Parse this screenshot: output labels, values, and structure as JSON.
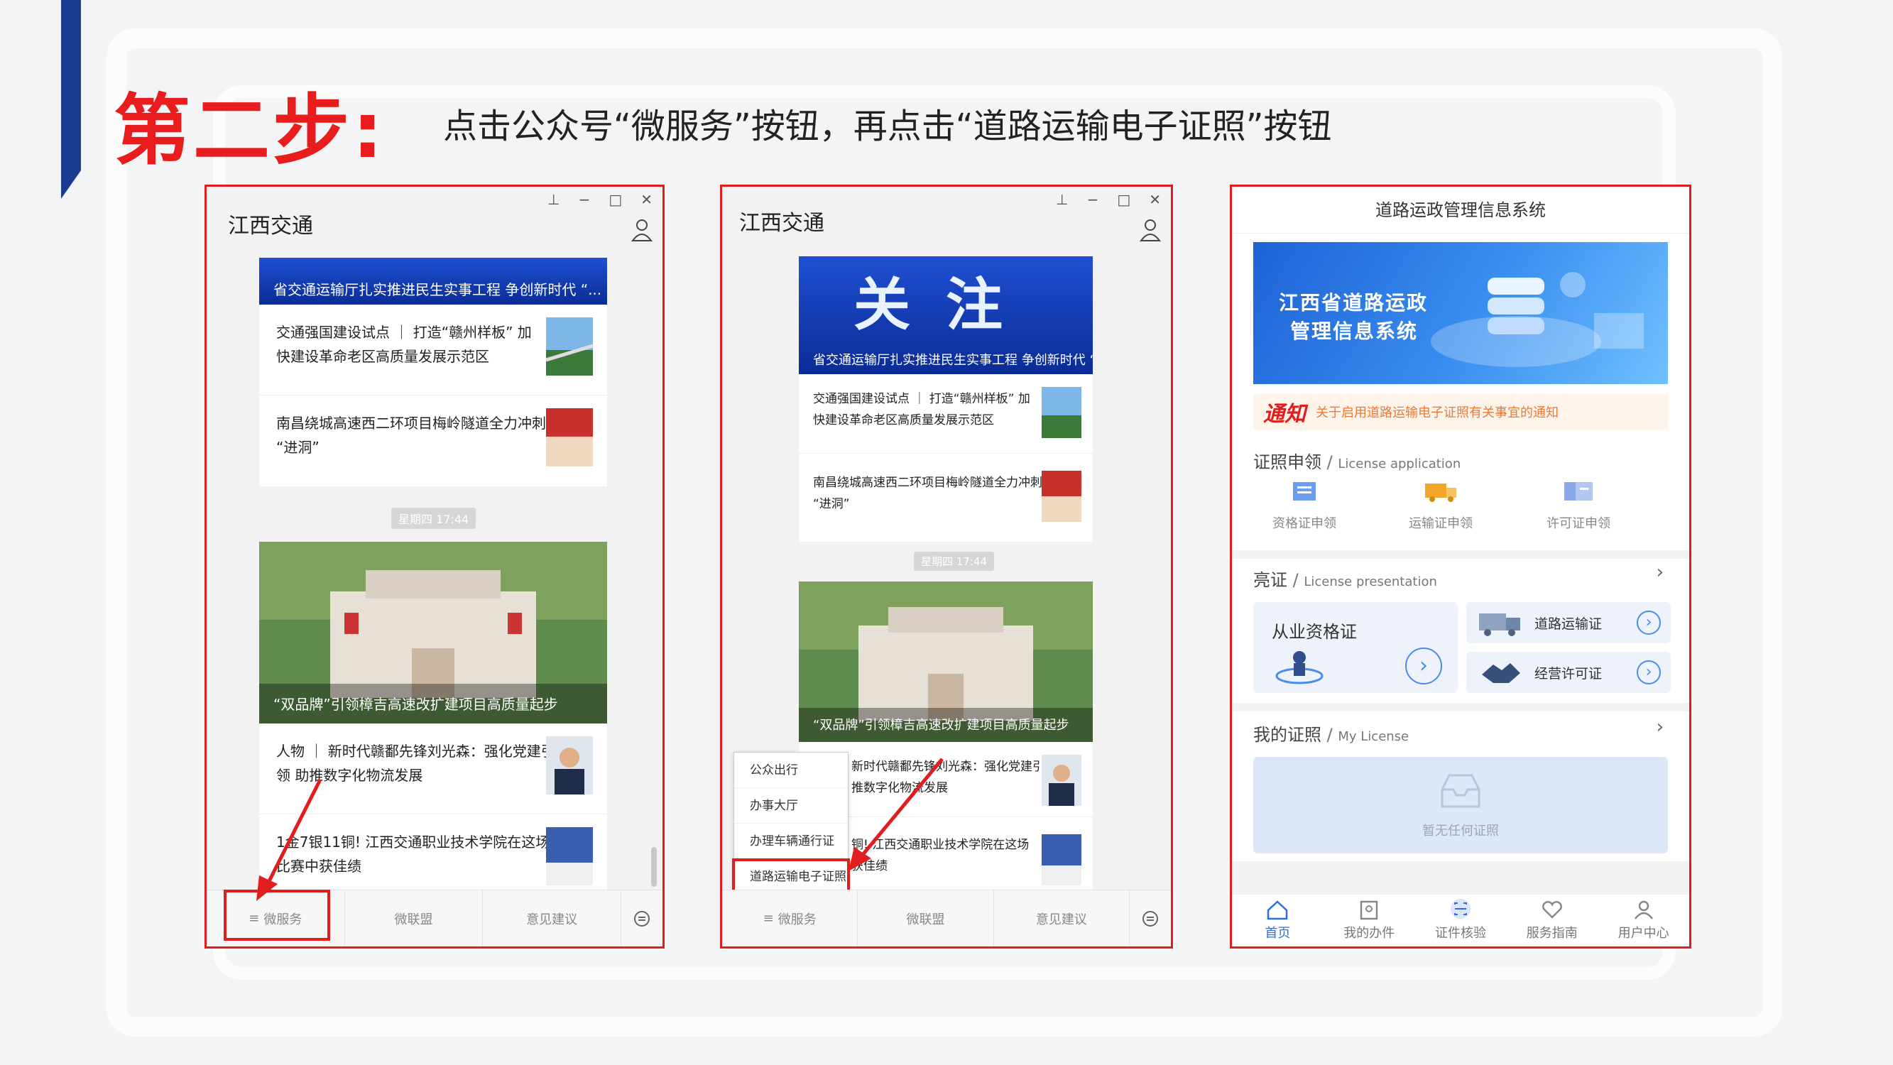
{
  "heading": {
    "step": "第二步:",
    "instruction": "点击公众号“微服务”按钮，再点击“道路运输电子证照”按钮"
  },
  "colors": {
    "accent_red": "#e11d1d",
    "brand_blue": "#1a3b8f",
    "link_blue": "#2f6fe0"
  },
  "wechat": {
    "title": "江西交通",
    "window_controls": [
      "pin-icon",
      "minimize-icon",
      "maximize-icon",
      "close-icon"
    ],
    "banner_caption": "省交通运输厅扎实推进民生实事工程 争创新时代 “...",
    "banner_big_text": "关注",
    "news_top": [
      {
        "line1": "交通强国建设试点 ｜ 打造“赣州样板” 加",
        "line2": "快建设革命老区高质量发展示范区"
      },
      {
        "line1": "南昌绕城高速西二环项目梅岭隧道全力冲刺",
        "line2": "“进洞”"
      }
    ],
    "timestamp": "星期四 17:44",
    "photo_caption": "“双品牌”引领樟吉高速改扩建项目高质量起步",
    "news_bottom": [
      {
        "line1": "人物 ｜ 新时代赣鄱先锋刘光森：强化党建引",
        "line2": "领 助推数字化物流发展"
      },
      {
        "line1": "1金7银11铜! 江西交通职业技术学院在这场",
        "line2": "比赛中获佳绩"
      }
    ],
    "news_bottom_p2": [
      {
        "line1": "新时代赣鄱先锋刘光森：强化党建引",
        "line2": "推数字化物流发展"
      },
      {
        "line1": "铜! 江西交通职业技术学院在这场",
        "line2": "获佳绩"
      }
    ],
    "menu": {
      "micro_service": "微服务",
      "micro_alliance": "微联盟",
      "feedback": "意见建议"
    },
    "submenu": [
      "公众出行",
      "办事大厅",
      "办理车辆通行证",
      "道路运输电子证照"
    ]
  },
  "app": {
    "header": "道路运政管理信息系统",
    "hero_line1": "江西省道路运政",
    "hero_line2": "管理信息系统",
    "notice_tag": "通知",
    "notice_text": "关于启用道路运输电子证照有关事宜的通知",
    "apply": {
      "title": "证照申领",
      "title_en": "License application",
      "items": [
        "资格证申领",
        "运输证申领",
        "许可证申领"
      ]
    },
    "present": {
      "title": "亮证",
      "title_en": "License presentation",
      "big": "从业资格证",
      "small": [
        "道路运输证",
        "经营许可证"
      ]
    },
    "mine": {
      "title": "我的证照",
      "title_en": "My License",
      "empty": "暂无任何证照"
    },
    "tabs": [
      "首页",
      "我的办件",
      "证件核验",
      "服务指南",
      "用户中心"
    ]
  }
}
